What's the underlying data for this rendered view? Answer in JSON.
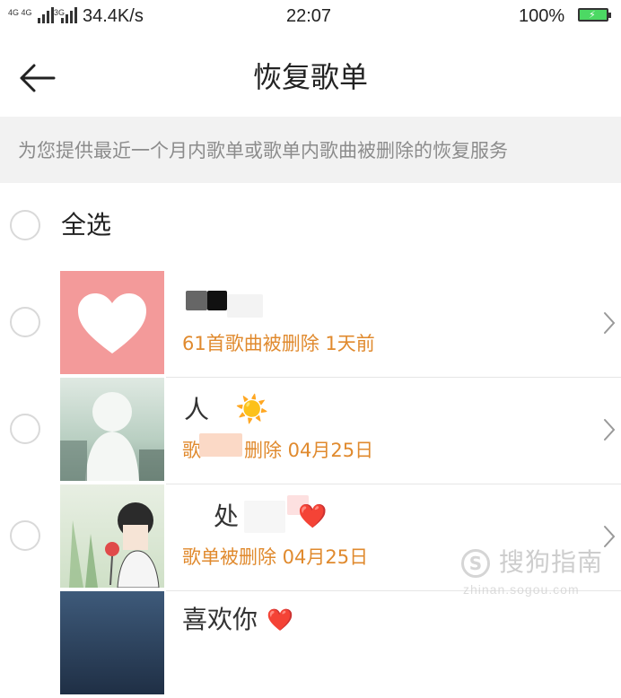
{
  "status_bar": {
    "net1_label": "4G 4G",
    "net2_label": "3G",
    "speed": "34.4K/s",
    "time": "22:07",
    "battery_pct": "100%",
    "battery_color": "#4cd964",
    "battery_icon": "battery-charging-icon"
  },
  "header": {
    "back_icon": "arrow-left-icon",
    "title": "恢复歌单"
  },
  "notice": "为您提供最近一个月内歌单或歌单内歌曲被删除的恢复服务",
  "select_all_label": "全选",
  "colors": {
    "accent": "#e08a2e",
    "notice_bg": "#f2f2f2",
    "heart_thumb_bg": "#f39a9a"
  },
  "playlists": [
    {
      "name": "",
      "subtitle": "61首歌曲被删除 1天前"
    },
    {
      "name": "人",
      "name_emoji": "☀️",
      "subtitle_prefix": "歌",
      "subtitle": "删除 04月25日"
    },
    {
      "name": "处",
      "name_emoji": "❤️",
      "subtitle": "歌单被删除 04月25日"
    },
    {
      "name": "喜欢你",
      "name_emoji": "❤️",
      "subtitle": ""
    }
  ],
  "watermark": {
    "name": "搜狗指南",
    "url": "zhinan.sogou.com"
  }
}
